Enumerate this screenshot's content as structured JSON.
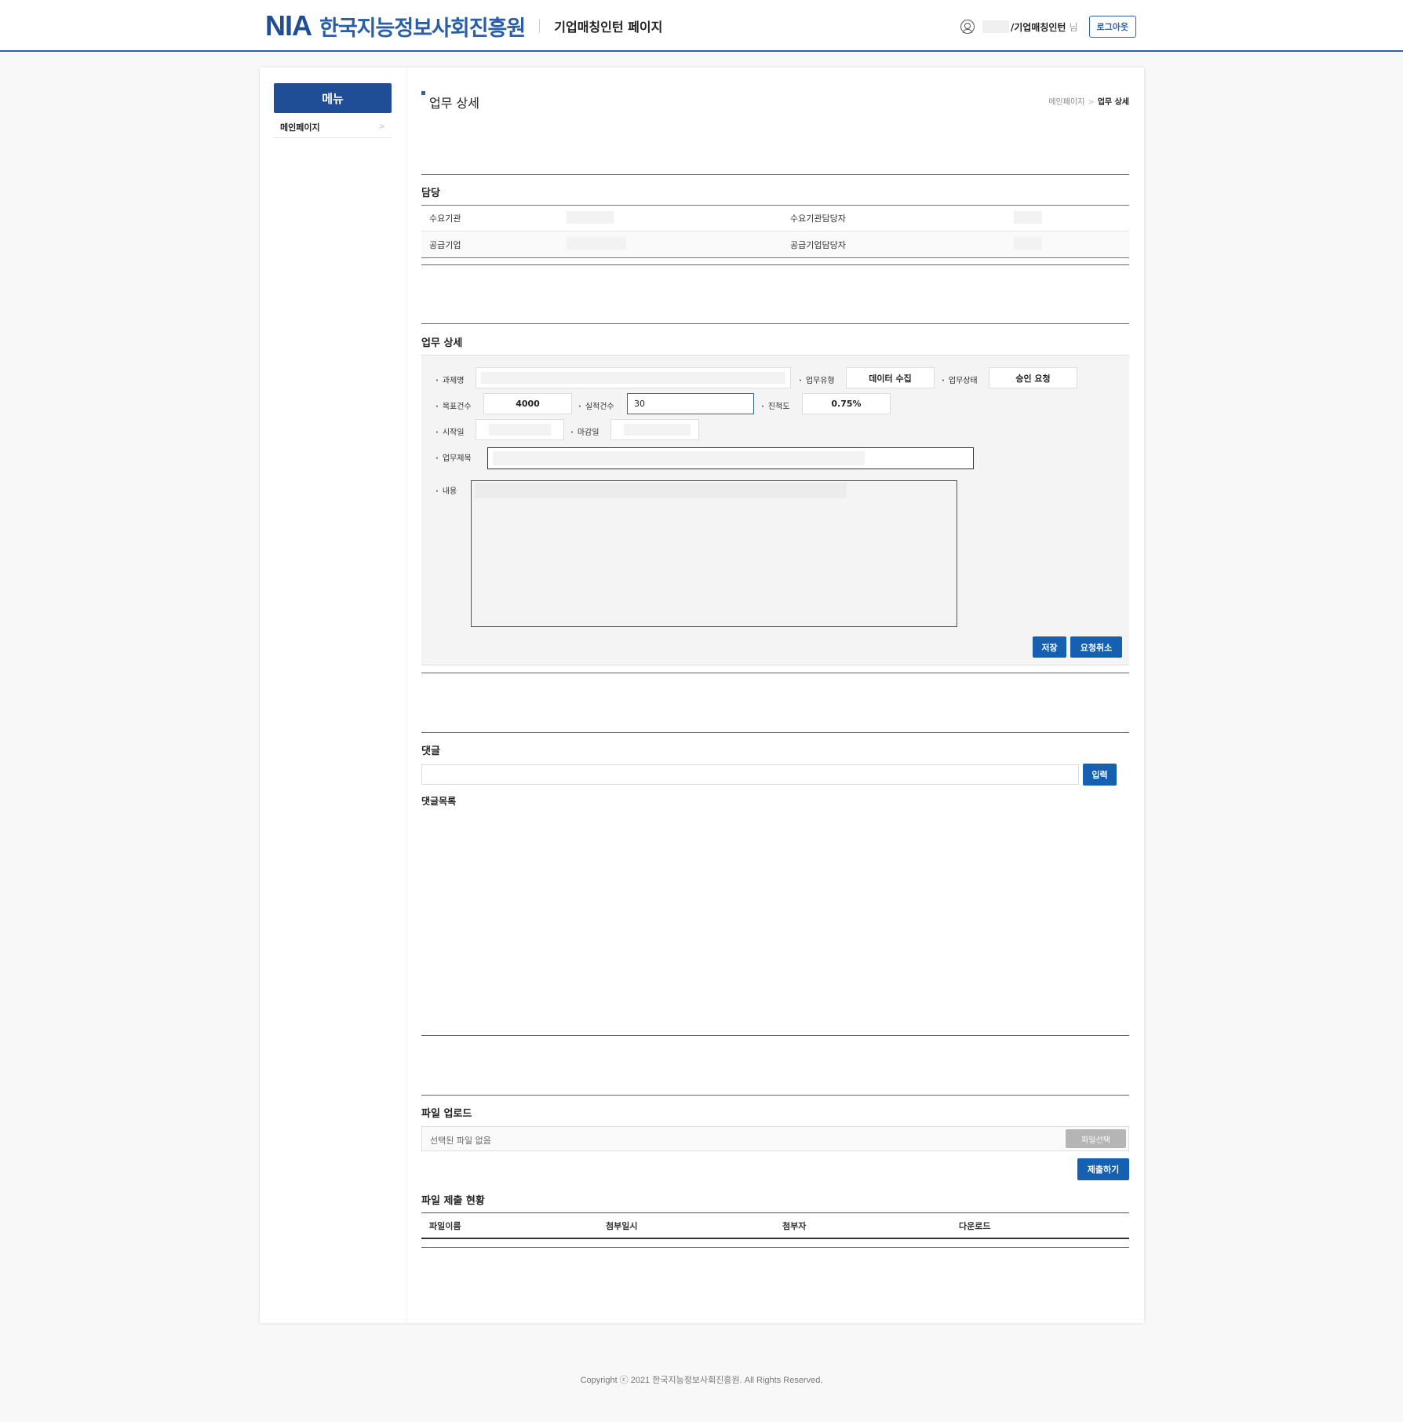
{
  "header": {
    "logo_nia": "NIA",
    "logo_korean": "한국지능정보사회진흥원",
    "subtitle": "기업매칭인턴 페이지",
    "user_role": "/기업매칭인턴",
    "user_suffix": "님",
    "logout_label": "로그아웃",
    "accent_color": "#1f4d96"
  },
  "sidebar": {
    "title": "메뉴",
    "items": [
      {
        "label": "메인페이지",
        "chevron": ">"
      }
    ]
  },
  "page": {
    "title": "업무 상세",
    "breadcrumb": {
      "home": "메인페이지",
      "separator": ">",
      "current": "업무 상세"
    }
  },
  "responsible": {
    "section_title": "담당",
    "rows": [
      {
        "label1": "수요기관",
        "label2": "수요기관담당자"
      },
      {
        "label1": "공급기업",
        "label2": "공급기업담당자"
      }
    ]
  },
  "detail": {
    "section_title": "업무 상세",
    "task_name_label": "과제명",
    "task_type_label": "업무유형",
    "task_type_value": "데이터 수집",
    "task_status_label": "업무상태",
    "task_status_value": "승인 요청",
    "target_label": "목표건수",
    "target_value": "4000",
    "actual_label": "실적건수",
    "actual_value": "30",
    "progress_label": "진척도",
    "progress_value": "0.75%",
    "start_label": "시작일",
    "end_label": "마감일",
    "work_title_label": "업무제목",
    "content_label": "내용",
    "save_label": "저장",
    "cancel_request_label": "요청취소"
  },
  "comments": {
    "section_title": "댓글",
    "submit_label": "입력",
    "list_title": "댓글목록"
  },
  "upload": {
    "section_title": "파일 업로드",
    "placeholder": "선택된 파일 없음",
    "pick_label": "파일선택",
    "submit_label": "제출하기"
  },
  "files": {
    "section_title": "파일 제출 현황",
    "columns": [
      "파일이름",
      "첨부일시",
      "첨부자",
      "다운로드"
    ]
  },
  "footer": {
    "copyright": "Copyright ⓒ 2021 한국지능정보사회진흥원. All Rights Reserved."
  }
}
